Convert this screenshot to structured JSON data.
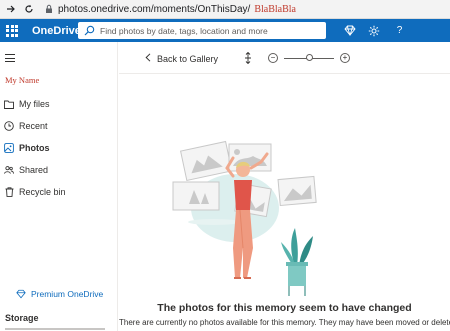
{
  "browser": {
    "url": "photos.onedrive.com/moments/OnThisDay/",
    "url_suffix": "BlaBlaBla"
  },
  "topbar": {
    "app_name": "OneDrive",
    "search_placeholder": "Find photos by date, tags, location and more",
    "help_label": "?"
  },
  "sidebar": {
    "user_name": "My Name",
    "items": [
      {
        "label": "My files",
        "icon": "folder-icon"
      },
      {
        "label": "Recent",
        "icon": "clock-icon"
      },
      {
        "label": "Photos",
        "icon": "image-icon",
        "active": true
      },
      {
        "label": "Shared",
        "icon": "people-icon"
      },
      {
        "label": "Recycle bin",
        "icon": "trash-icon"
      }
    ],
    "premium_label": "Premium OneDrive",
    "storage_label": "Storage"
  },
  "main": {
    "back_label": "Back to Gallery",
    "zoom_minus": "−",
    "zoom_plus": "+",
    "zoom_level": 0.5,
    "empty_title": "The photos for this memory seem to have changed",
    "empty_subtitle": "There are currently no photos available for this memory. They may have been moved or deleted."
  },
  "colors": {
    "brand_blue": "#0f6cbd",
    "user_name_red": "#c0392b"
  }
}
